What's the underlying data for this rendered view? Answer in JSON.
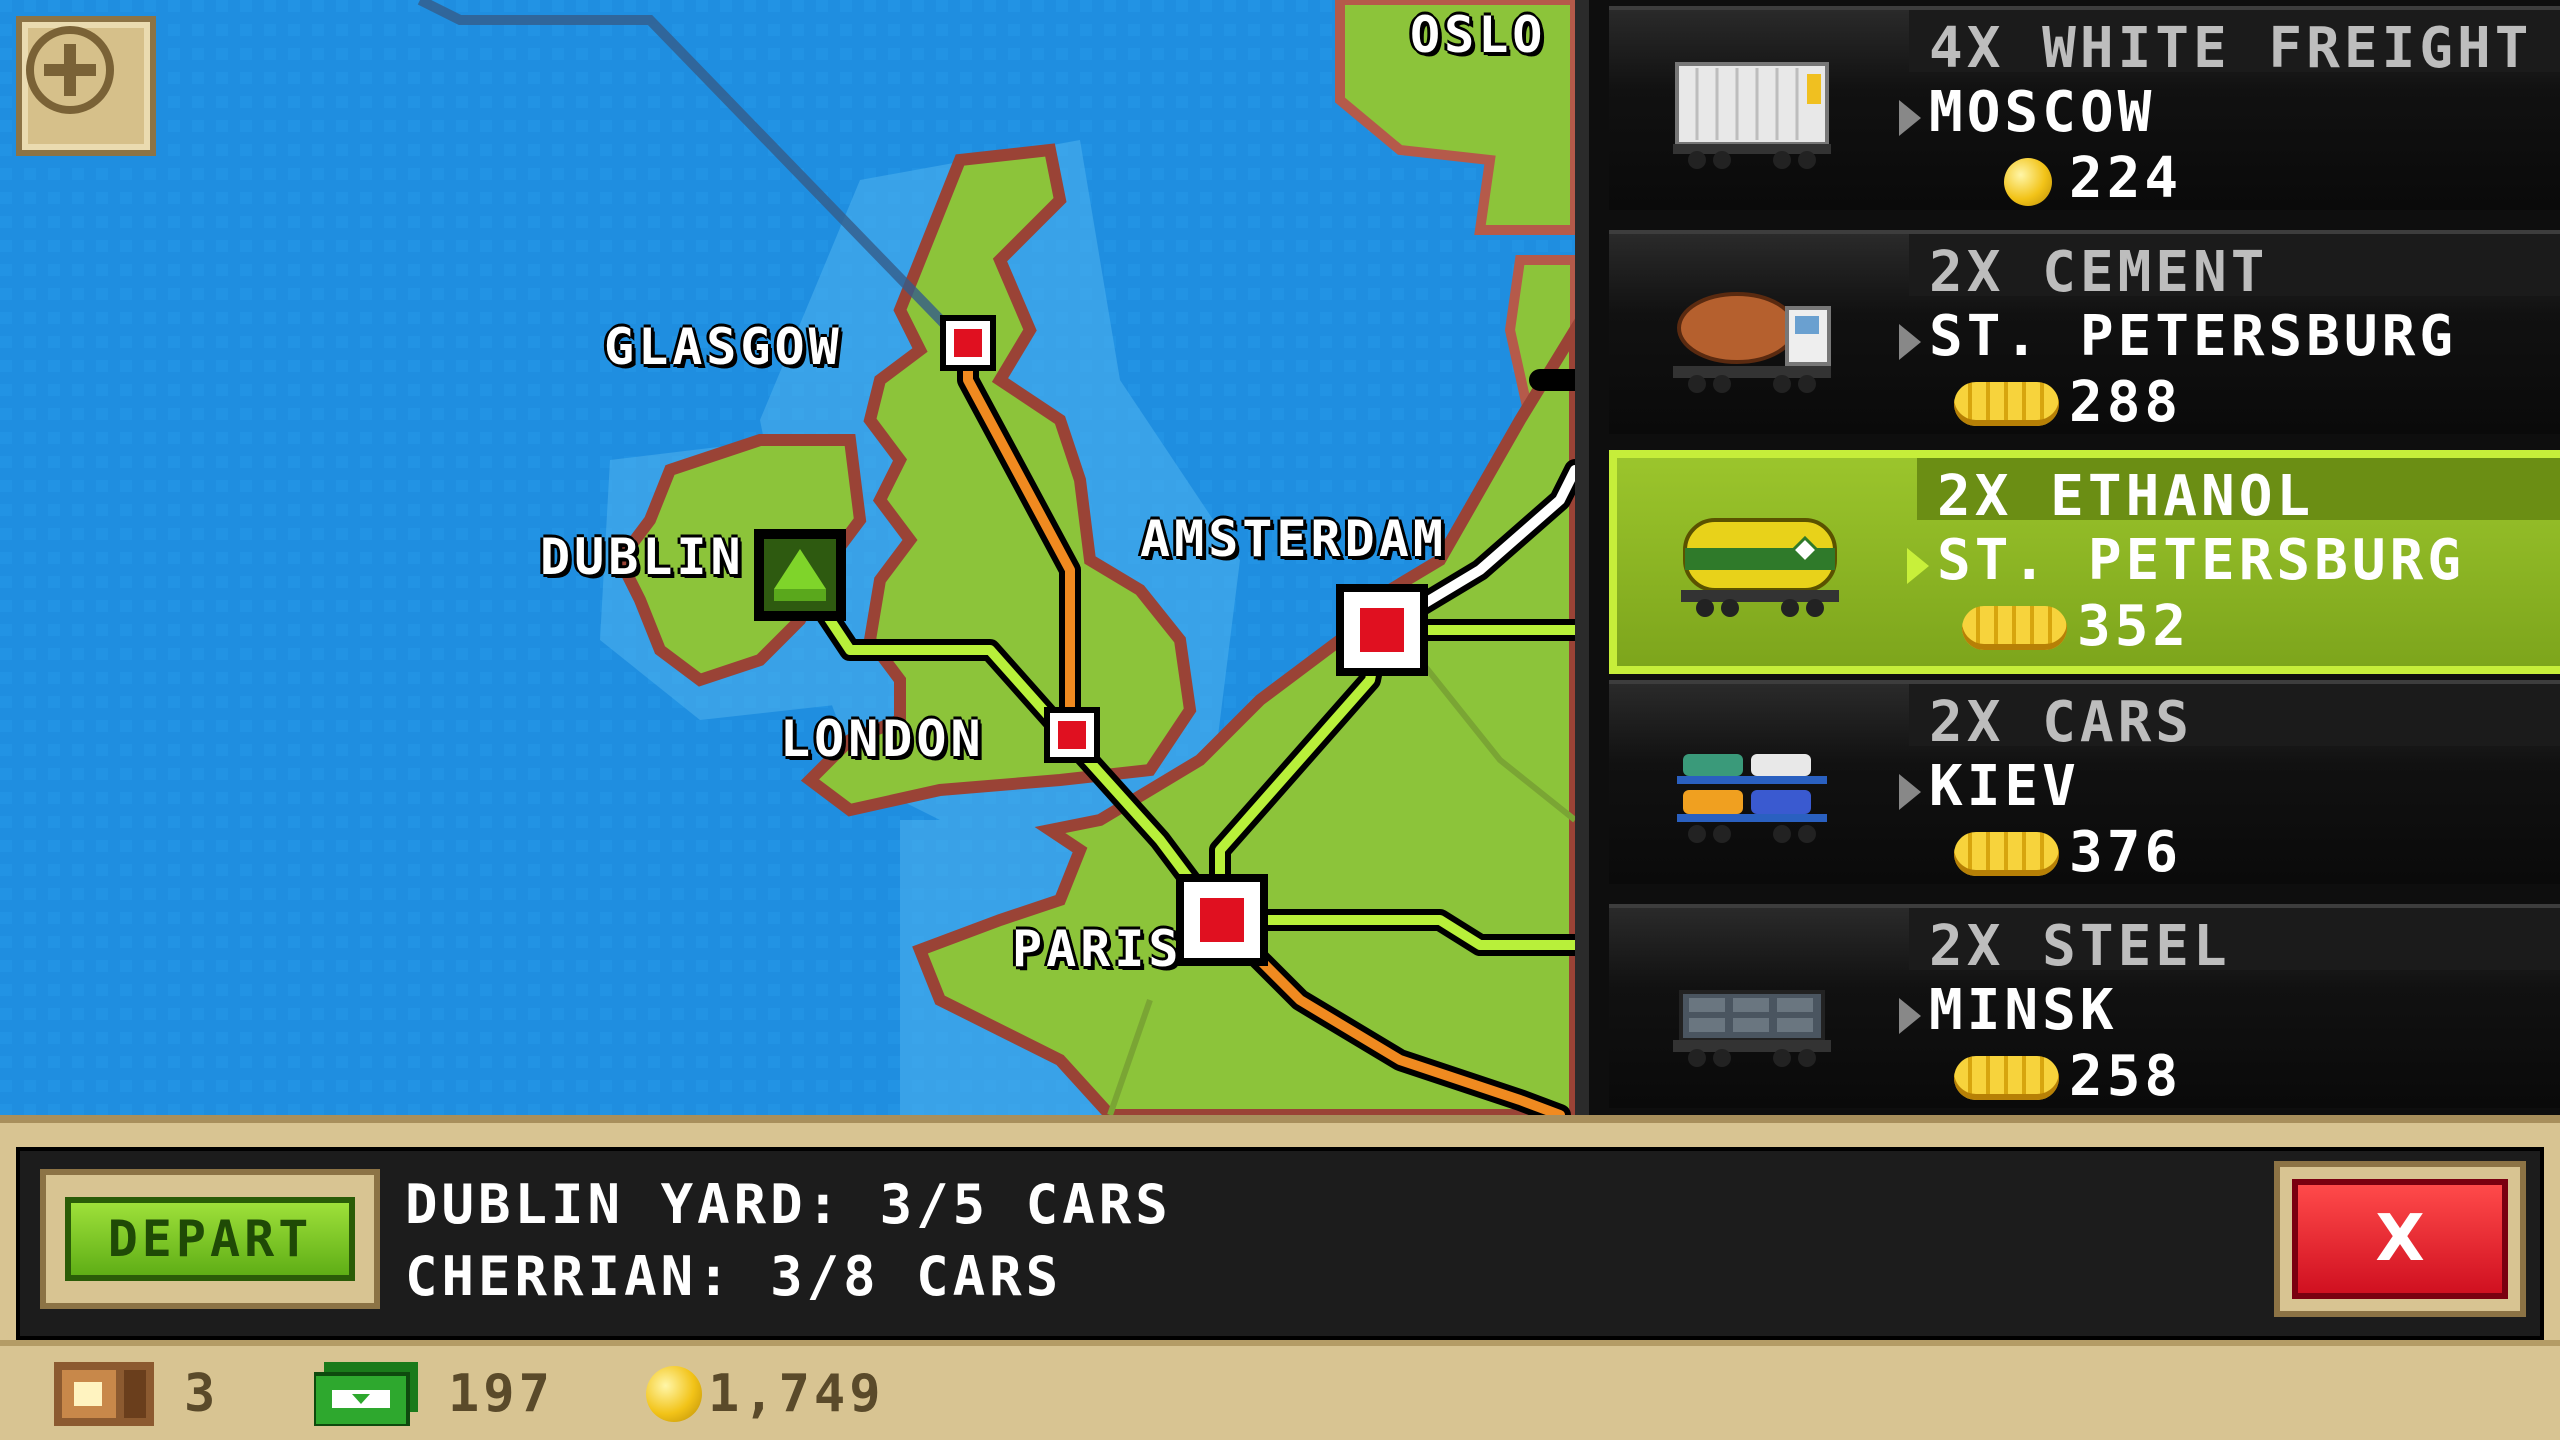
{
  "map": {
    "cities": [
      {
        "id": "oslo",
        "label": "OSLO"
      },
      {
        "id": "glasgow",
        "label": "GLASGOW"
      },
      {
        "id": "dublin",
        "label": "DUBLIN"
      },
      {
        "id": "amsterdam",
        "label": "AMSTERDAM"
      },
      {
        "id": "london",
        "label": "LONDON"
      },
      {
        "id": "paris",
        "label": "PARIS"
      }
    ]
  },
  "cargo": [
    {
      "qty": "4X WHITE FREIGHT",
      "dest": "MOSCOW",
      "pay": "224",
      "pay_icon": "coin-icon",
      "wagon": "container-wagon",
      "selected": false
    },
    {
      "qty": "2X CEMENT",
      "dest": "ST. PETERSBURG",
      "pay": "288",
      "pay_icon": "gold-bars-icon",
      "wagon": "cement-mixer-wagon",
      "selected": false
    },
    {
      "qty": "2X ETHANOL",
      "dest": "ST. PETERSBURG",
      "pay": "352",
      "pay_icon": "gold-bars-icon",
      "wagon": "tank-wagon",
      "selected": true
    },
    {
      "qty": "2X CARS",
      "dest": "KIEV",
      "pay": "376",
      "pay_icon": "gold-bars-icon",
      "wagon": "car-carrier-wagon",
      "selected": false
    },
    {
      "qty": "2X STEEL",
      "dest": "MINSK",
      "pay": "258",
      "pay_icon": "gold-bars-icon",
      "wagon": "steel-wagon",
      "selected": false
    }
  ],
  "bottom": {
    "depart_label": "DEPART",
    "line1": "DUBLIN YARD: 3/5 CARS",
    "line2": "CHERRIAN: 3/8 CARS",
    "close_label": "X"
  },
  "status": {
    "stations": "3",
    "cash": "197",
    "coins": "1,749"
  },
  "colors": {
    "sea": "#1f8ee0",
    "land": "#8cc43a",
    "selected_card": "#9bc52c",
    "track_green": "#b8f03a",
    "track_orange": "#f08a20"
  }
}
